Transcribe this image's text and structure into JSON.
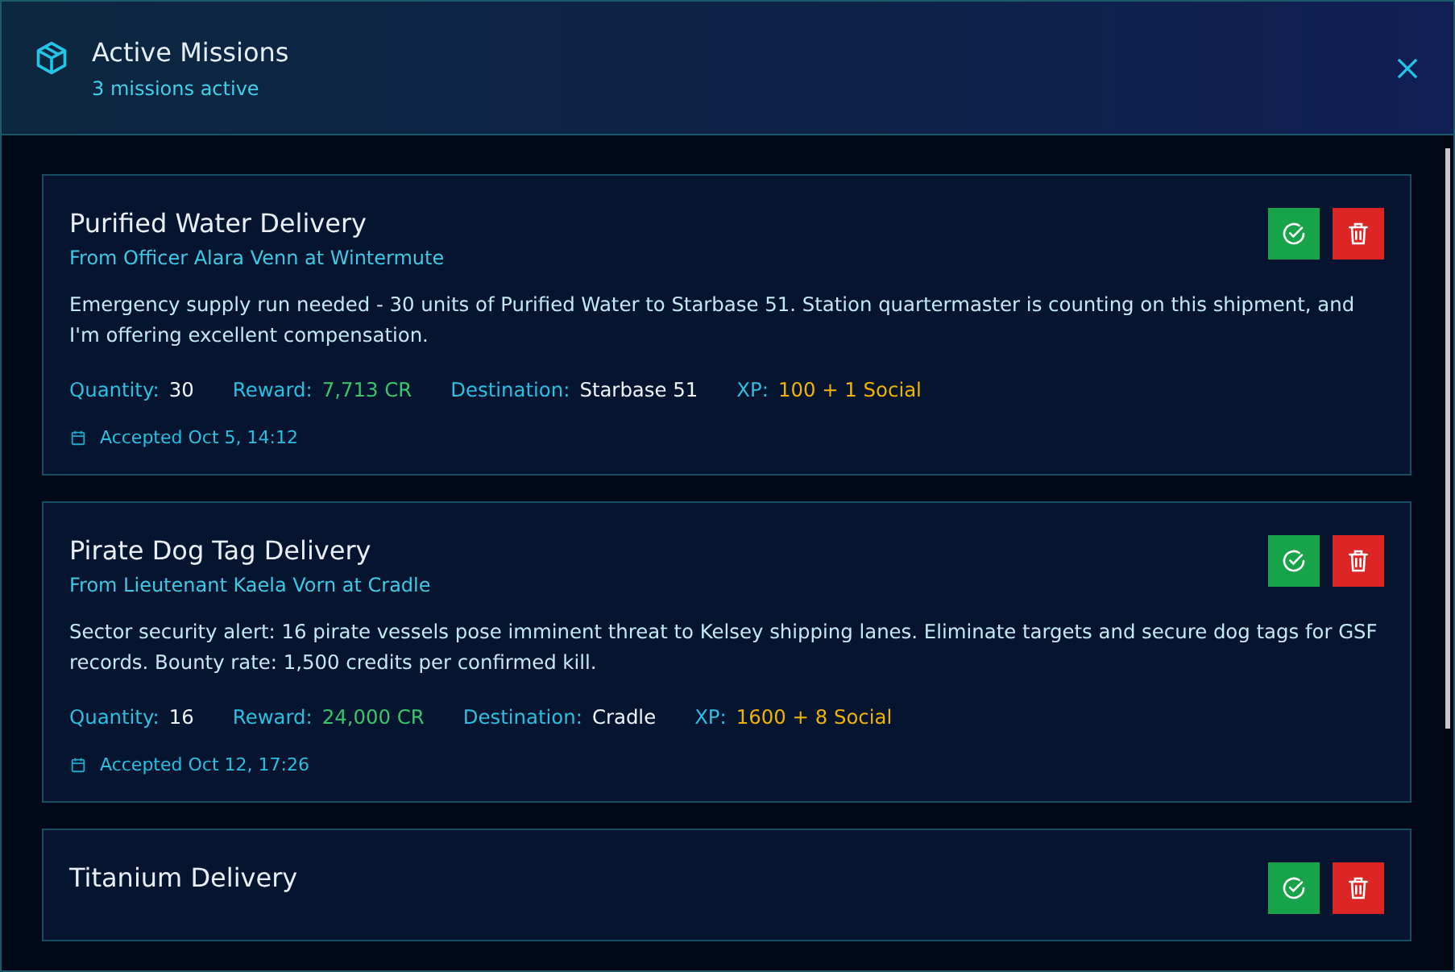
{
  "header": {
    "title": "Active Missions",
    "subtitle": "3 missions active"
  },
  "missions": [
    {
      "title": "Purified Water Delivery",
      "from": "From Officer Alara Venn at Wintermute",
      "description": "Emergency supply run needed - 30 units of Purified Water to Starbase 51. Station quartermaster is counting on this shipment, and I'm offering excellent compensation.",
      "fields": [
        {
          "kind": "plain",
          "label": "Quantity:",
          "value": "30"
        },
        {
          "kind": "reward",
          "label": "Reward:",
          "value": "7,713 CR"
        },
        {
          "kind": "plain",
          "label": "Destination:",
          "value": "Starbase 51"
        },
        {
          "kind": "xp",
          "label": "XP:",
          "value": "100 + 1 Social"
        }
      ],
      "accepted": "Accepted Oct 5, 14:12"
    },
    {
      "title": "Pirate Dog Tag Delivery",
      "from": "From Lieutenant Kaela Vorn at Cradle",
      "description": "Sector security alert: 16 pirate vessels pose imminent threat to Kelsey shipping lanes. Eliminate targets and secure dog tags for GSF records. Bounty rate: 1,500 credits per confirmed kill.",
      "fields": [
        {
          "kind": "plain",
          "label": "Quantity:",
          "value": "16"
        },
        {
          "kind": "reward",
          "label": "Reward:",
          "value": "24,000 CR"
        },
        {
          "kind": "plain",
          "label": "Destination:",
          "value": "Cradle"
        },
        {
          "kind": "xp",
          "label": "XP:",
          "value": "1600 + 8 Social"
        }
      ],
      "accepted": "Accepted Oct 12, 17:26"
    },
    {
      "title": "Titanium Delivery"
    }
  ]
}
